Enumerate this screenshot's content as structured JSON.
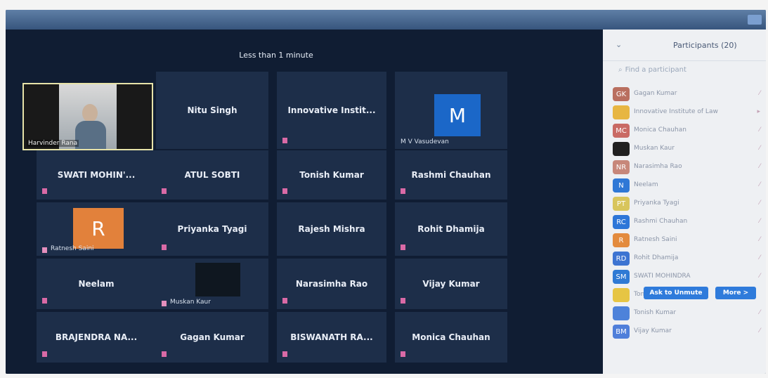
{
  "meeting": {
    "notice": "Less than 1 minute"
  },
  "video_tile": {
    "name": "Harvinder Rana"
  },
  "tiles": {
    "nitu": "Nitu Singh",
    "innovative": "Innovative Instit...",
    "mv_letter": "M",
    "mv_name": "M V Vasudevan",
    "swati": "SWATI MOHIN'...",
    "atul": "ATUL SOBTI",
    "tonish": "Tonish Kumar",
    "rashmi": "Rashmi Chauhan",
    "r_letter": "R",
    "r_name": "Ratnesh Saini",
    "priyanka": "Priyanka Tyagi",
    "rajesh": "Rajesh Mishra",
    "rohit": "Rohit Dhamija",
    "neelam": "Neelam",
    "muskan": "Muskan Kaur",
    "narasimha": "Narasimha Rao",
    "vijay": "Vijay Kumar",
    "brajendra": "BRAJENDRA NA...",
    "gagan": "Gagan Kumar",
    "biswanath": "BISWANATH RA...",
    "monica": "Monica Chauhan"
  },
  "panel": {
    "title": "Participants (20)",
    "search_placeholder": "Find a participant",
    "unmute_button": "Ask to Unmute",
    "more_button": "More >"
  },
  "participants": [
    {
      "initials": "GK",
      "name": "Gagan Kumar",
      "color": "#b96f5f"
    },
    {
      "initials": "",
      "name": "Innovative Institute of Law",
      "color": "#e7b642"
    },
    {
      "initials": "MC",
      "name": "Monica Chauhan",
      "color": "#c96a64"
    },
    {
      "initials": "",
      "name": "Muskan Kaur",
      "color": "#202020"
    },
    {
      "initials": "NR",
      "name": "Narasimha Rao",
      "color": "#c7877a"
    },
    {
      "initials": "N",
      "name": "Neelam",
      "color": "#2f78d6"
    },
    {
      "initials": "PT",
      "name": "Priyanka Tyagi",
      "color": "#d8c55c"
    },
    {
      "initials": "RC",
      "name": "Rashmi Chauhan",
      "color": "#2d76d8"
    },
    {
      "initials": "R",
      "name": "Ratnesh Saini",
      "color": "#e38b3e"
    },
    {
      "initials": "RD",
      "name": "Rohit Dhamija",
      "color": "#3d74d2"
    },
    {
      "initials": "SM",
      "name": "SWATI MOHINDRA",
      "color": "#2f7ad4"
    },
    {
      "initials": "",
      "name": "Tonish",
      "color": "#e6c544"
    },
    {
      "initials": "",
      "name": "Tonish Kumar",
      "color": "#4d82da"
    },
    {
      "initials": "BM",
      "name": "Vijay Kumar",
      "color": "#4f7fda"
    }
  ]
}
